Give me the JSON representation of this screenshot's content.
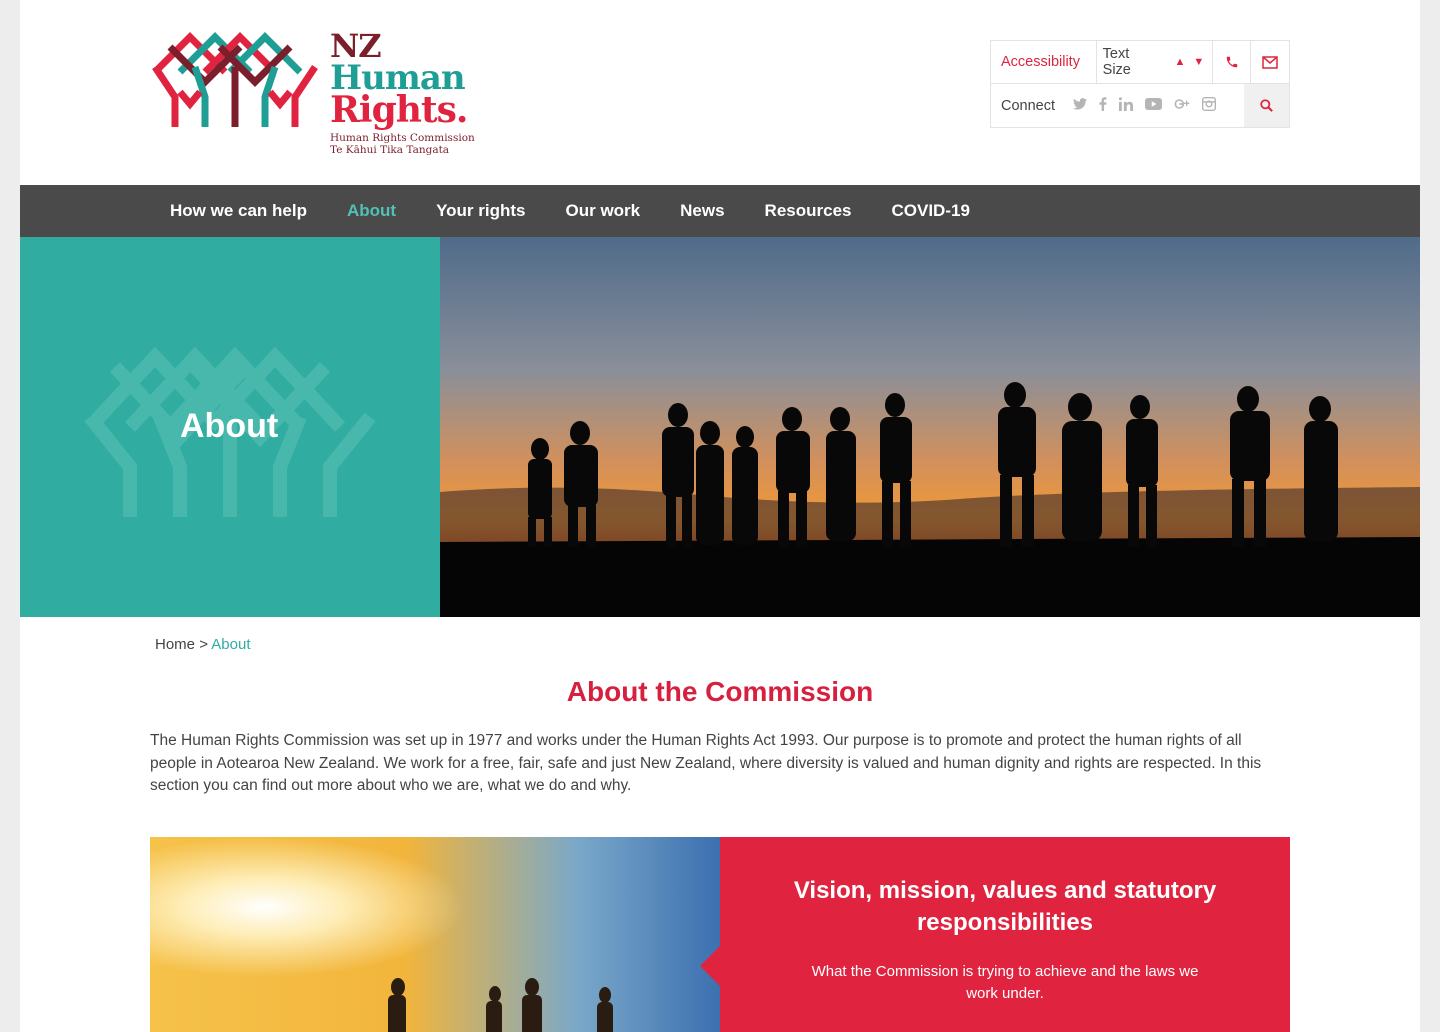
{
  "logo": {
    "line1": "NZ",
    "line2": "Human",
    "line3": "Rights.",
    "sub1": "Human Rights Commission",
    "sub2": "Te Kāhui Tika Tangata"
  },
  "utility": {
    "accessibility": "Accessibility",
    "text_size": "Text Size",
    "connect": "Connect"
  },
  "nav": [
    {
      "label": "How we can help"
    },
    {
      "label": "About"
    },
    {
      "label": "Your rights"
    },
    {
      "label": "Our work"
    },
    {
      "label": "News"
    },
    {
      "label": "Resources"
    },
    {
      "label": "COVID-19"
    }
  ],
  "hero": {
    "title": "About"
  },
  "breadcrumb": {
    "home": "Home",
    "sep": ">",
    "current": "About"
  },
  "main": {
    "title": "About the Commission",
    "intro": "The Human Rights Commission was set up in 1977 and works under the Human Rights Act 1993. Our purpose is to promote and protect the human rights of all people in Aotearoa New Zealand. We work for a free, fair, safe and just New Zealand, where diversity is valued and human dignity and rights are respected. In this section you can find out more about who we are, what we do and why."
  },
  "card": {
    "title": "Vision, mission, values and statutory responsibilities",
    "desc": "What the Commission is trying to achieve and the laws we work under."
  },
  "colors": {
    "accent_red": "#e0243f",
    "teal": "#31aca1",
    "nav_bg": "#4a4a4a",
    "maroon": "#7a1f2b"
  }
}
